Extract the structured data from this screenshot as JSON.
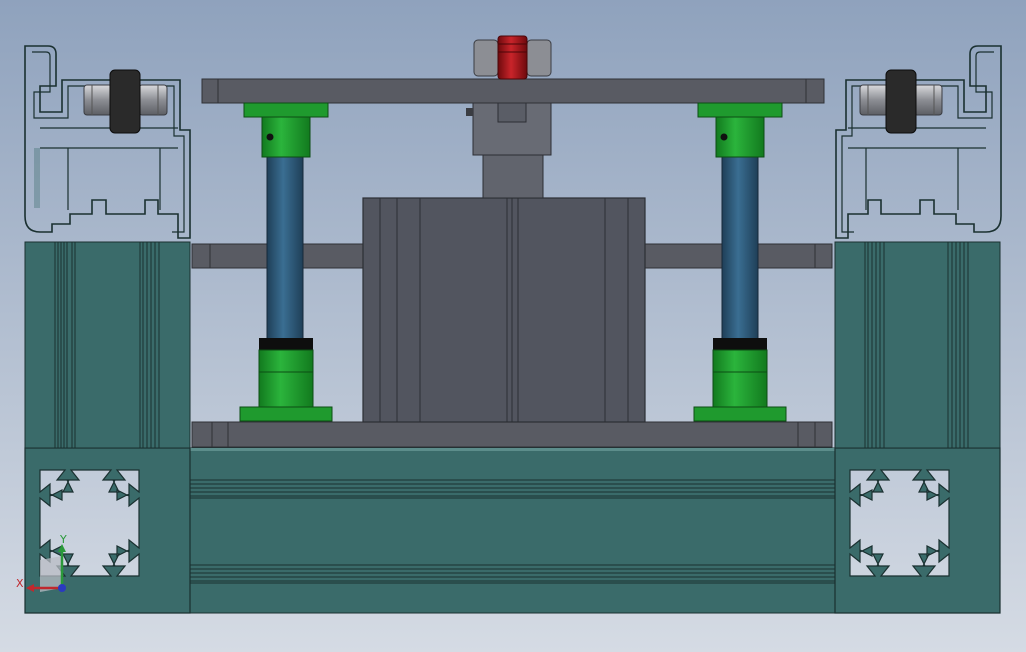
{
  "view": {
    "background_top": "#8fa2bd",
    "background_bottom": "#d5dbe4"
  },
  "colors": {
    "extrusion": "#3a6b6a",
    "extrusion_dark": "#244a49",
    "extrusion_light": "#5c8d8b",
    "plate": "#595b63",
    "plate_edge": "#2f3036",
    "green": "#1f9a2e",
    "green_dark": "#147a20",
    "rod": "#2c5878",
    "motor": "#52555f",
    "motor_edge": "#2c2e34",
    "roller": "#2a2a2a",
    "hub": "#9c9ea4",
    "red_knob": "#b0151a"
  },
  "icons": {
    "left_profile": "aluminum-profile-icon",
    "right_profile": "aluminum-profile-icon",
    "left_wheel": "roller-wheel-icon",
    "right_wheel": "roller-wheel-icon",
    "triad": "coordinate-triad-icon"
  },
  "triad": {
    "x_label": "X",
    "y_label": "Y",
    "x_color": "#c0282d",
    "y_color": "#2a9a3a",
    "z_color": "#2a3ac0"
  }
}
